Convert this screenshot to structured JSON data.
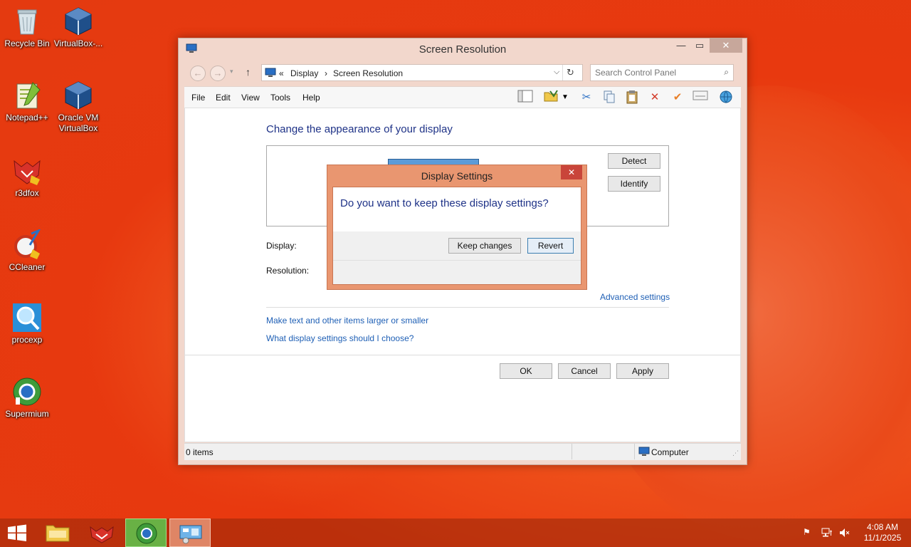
{
  "desktop": {
    "icons": [
      {
        "label": "Recycle Bin"
      },
      {
        "label": "VirtualBox-..."
      },
      {
        "label": "Notepad++"
      },
      {
        "label": "Oracle VM VirtualBox"
      },
      {
        "label": "r3dfox"
      },
      {
        "label": "CCleaner"
      },
      {
        "label": "procexp"
      },
      {
        "label": "Supermium"
      }
    ]
  },
  "window": {
    "title": "Screen Resolution",
    "breadcrumb": [
      "«",
      "Display",
      "›",
      "Screen Resolution"
    ],
    "search_placeholder": "Search Control Panel",
    "menu": [
      "File",
      "Edit",
      "View",
      "Tools",
      "Help"
    ],
    "heading": "Change the appearance of your display",
    "detect_label": "Detect",
    "identify_label": "Identify",
    "display_label": "Display:",
    "resolution_label": "Resolution:",
    "advanced_link": "Advanced settings",
    "link_text_size": "Make text and other items larger or smaller",
    "link_help": "What display settings should I choose?",
    "ok_label": "OK",
    "cancel_label": "Cancel",
    "apply_label": "Apply",
    "status_items": "0 items",
    "status_computer": "Computer"
  },
  "dialog": {
    "title": "Display Settings",
    "message": "Do you want to keep these display settings?",
    "keep_label": "Keep changes",
    "revert_label": "Revert",
    "close_glyph": "✕"
  },
  "taskbar": {
    "time": "4:08 AM",
    "date": "11/1/2025"
  },
  "colors": {
    "accent_blue": "#1e3287",
    "link_blue": "#1e5fb5",
    "window_frame": "#f2d7cc",
    "dialog_frame": "#e99670",
    "desktop": "#e8390f"
  }
}
